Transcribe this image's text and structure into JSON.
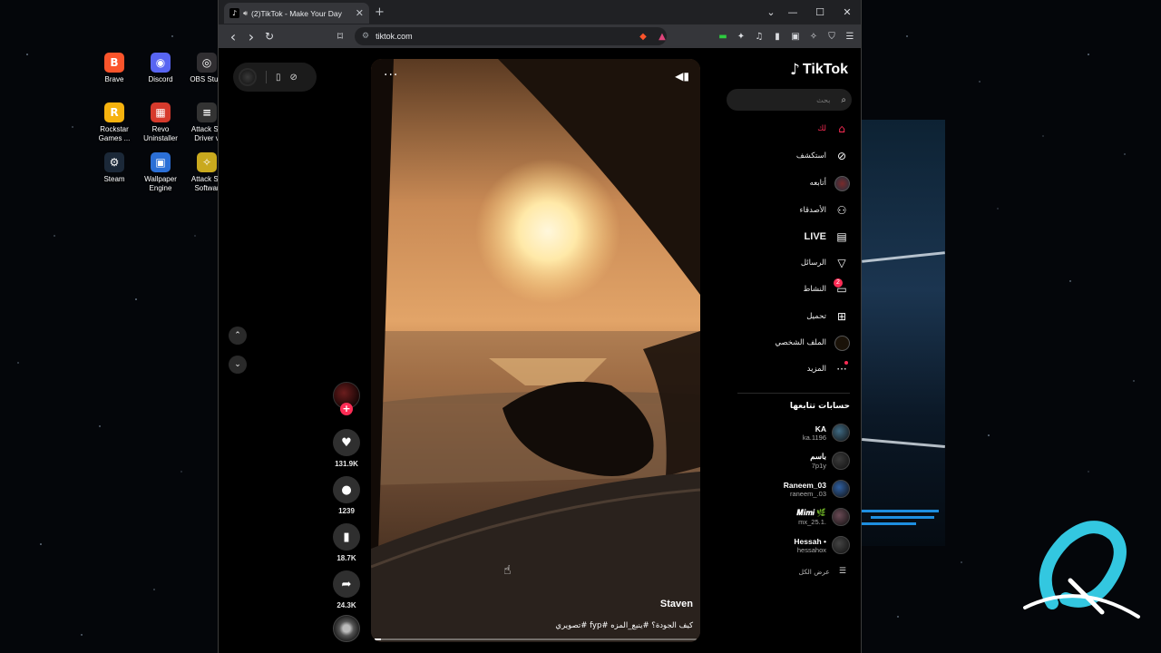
{
  "desktop": {
    "icons": [
      {
        "label": "Brave",
        "icon": "brave-icon",
        "color": "#fb542b"
      },
      {
        "label": "Discord",
        "icon": "discord-icon",
        "color": "#5865f2"
      },
      {
        "label": "OBS Studi",
        "icon": "obs-icon",
        "color": "#302e31"
      },
      {
        "label": "Rockstar\nGames ...",
        "icon": "rockstar-icon",
        "color": "#f6b20e"
      },
      {
        "label": "Revo\nUninstaller",
        "icon": "revo-icon",
        "color": "#d63a2c"
      },
      {
        "label": "Attack Sh\nDriver v",
        "icon": "attack-shark-icon",
        "color": "#333333"
      },
      {
        "label": "Steam",
        "icon": "steam-icon",
        "color": "#1b2838"
      },
      {
        "label": "Wallpaper\nEngine",
        "icon": "wallpaper-engine-icon",
        "color": "#2b6fd6"
      },
      {
        "label": "Attack Sh\nSoftwar",
        "icon": "attack-shark-software-icon",
        "color": "#c9a91e"
      }
    ]
  },
  "browser": {
    "tab_title": "(2)TikTok - Make Your Day",
    "url": "tiktok.com",
    "glyphs": {
      "close": "✕",
      "new_tab": "+",
      "chevron": "⌄",
      "minimize": "—",
      "maximize": "☐",
      "back": "‹",
      "forward": "›",
      "reload": "↻",
      "bookmark": "⌑"
    }
  },
  "page": {
    "video": {
      "author": "Staven",
      "caption": "كيف الجودة؟ #ينبع_المزه #fyp #تصويري",
      "more": "···",
      "progress": 0.02
    },
    "actions": {
      "follow": "+",
      "like_count": "131.9K",
      "comment_count": "1239",
      "save_count": "18.7K",
      "share_count": "24.3K"
    },
    "sidebar": {
      "brand": "TikTok",
      "search_placeholder": "بحث",
      "nav": [
        {
          "label": "لك",
          "icon": "home-icon"
        },
        {
          "label": "استكشف",
          "icon": "compass-icon"
        },
        {
          "label": "أتابعه",
          "icon": "following-avatar-icon"
        },
        {
          "label": "الأصدقاء",
          "icon": "friends-icon"
        },
        {
          "label": "LIVE",
          "icon": "live-icon"
        },
        {
          "label": "الرسائل",
          "icon": "messages-icon"
        },
        {
          "label": "النشاط",
          "icon": "activity-icon",
          "badge": "2"
        },
        {
          "label": "تحميل",
          "icon": "upload-icon"
        },
        {
          "label": "الملف الشخصي",
          "icon": "profile-icon"
        },
        {
          "label": "المزيد",
          "icon": "more-icon"
        }
      ],
      "following_title": "حسابات تتابعها",
      "accounts": [
        {
          "name": "KA",
          "handle": "ka.1196"
        },
        {
          "name": "باسم",
          "handle": "7p1y"
        },
        {
          "name": "Raneem_03",
          "handle": "raneem_.03"
        },
        {
          "name": "𝑴𝒊𝒎𝒊 🌿",
          "handle": "mx_25.1."
        },
        {
          "name": "Hessah •",
          "handle": "hessahox"
        }
      ],
      "see_all": "عرض الكل"
    }
  }
}
